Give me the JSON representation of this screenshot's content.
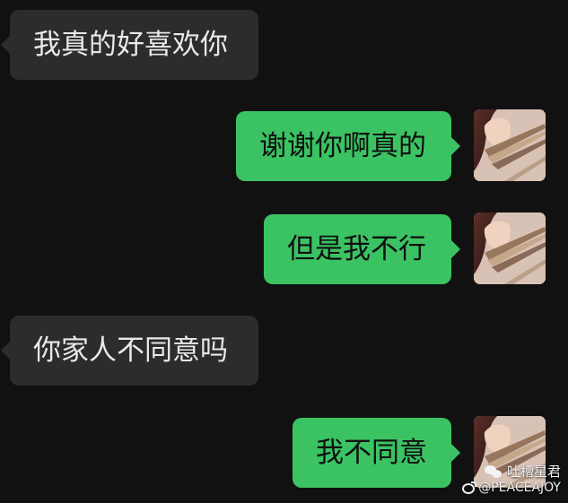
{
  "messages": [
    {
      "side": "left",
      "text": "我真的好喜欢你"
    },
    {
      "side": "right",
      "text": "谢谢你啊真的"
    },
    {
      "side": "right",
      "text": "但是我不行"
    },
    {
      "side": "left",
      "text": "你家人不同意吗"
    },
    {
      "side": "right",
      "text": "我不同意"
    }
  ],
  "watermark": {
    "brand": "吐槽星君",
    "handle": "@PEACEAJOY",
    "icons": [
      "wechat-icon",
      "weibo-icon"
    ]
  },
  "colors": {
    "background": "#111111",
    "incoming_bubble": "#2c2c2c",
    "outgoing_bubble": "#3bc363",
    "incoming_text": "#e9e9e9",
    "outgoing_text": "#101010"
  }
}
